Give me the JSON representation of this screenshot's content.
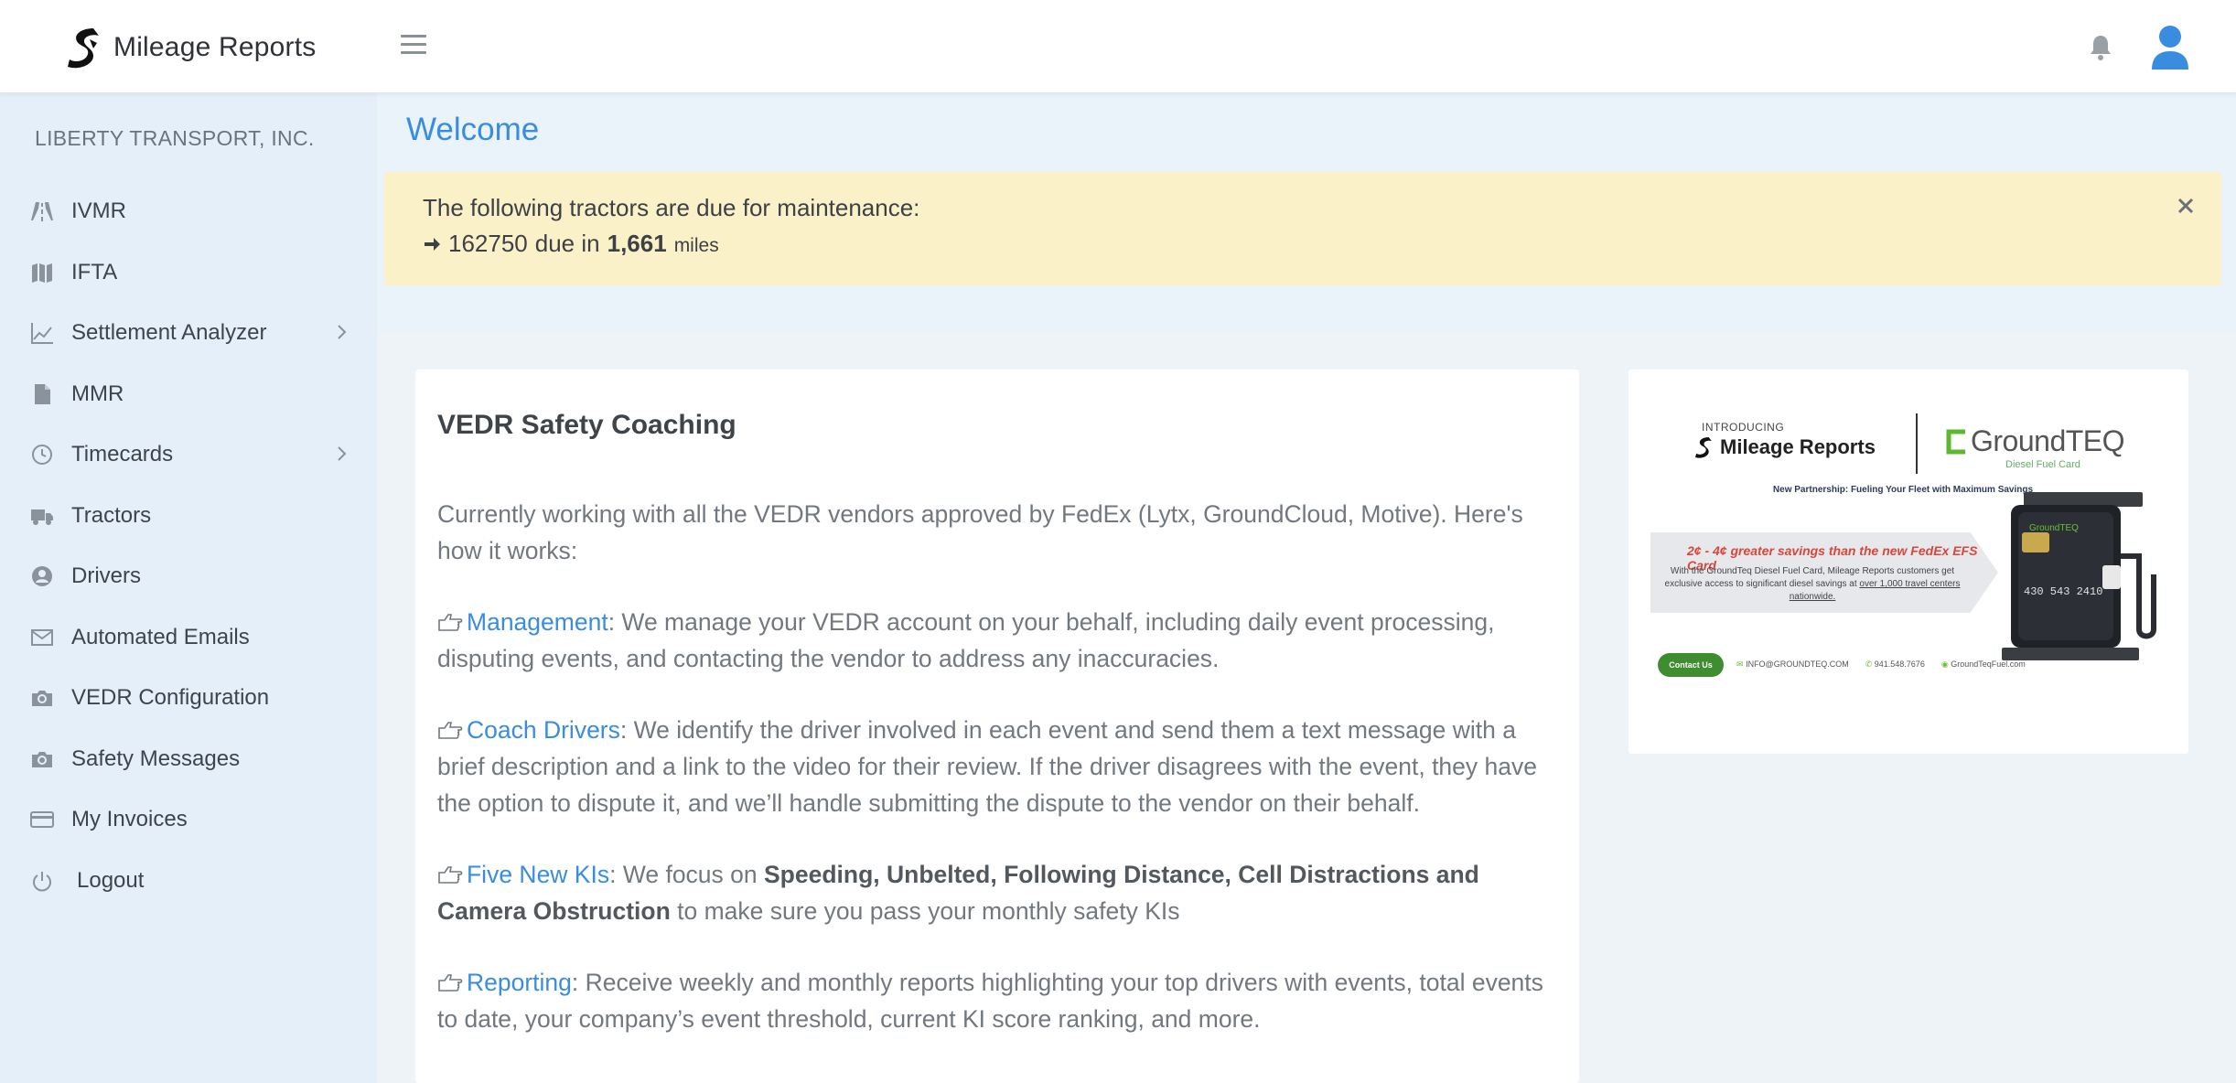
{
  "header": {
    "brand_name": "Mileage Reports",
    "icons": [
      "menu-icon",
      "bell-icon",
      "user-avatar-icon"
    ]
  },
  "sidebar": {
    "company": "LIBERTY TRANSPORT, INC.",
    "items": [
      {
        "label": "IVMR",
        "icon": "road-icon",
        "has_submenu": false
      },
      {
        "label": "IFTA",
        "icon": "map-icon",
        "has_submenu": false
      },
      {
        "label": "Settlement Analyzer",
        "icon": "line-chart-icon",
        "has_submenu": true
      },
      {
        "label": "MMR",
        "icon": "file-icon",
        "has_submenu": false
      },
      {
        "label": "Timecards",
        "icon": "clock-icon",
        "has_submenu": true
      },
      {
        "label": "Tractors",
        "icon": "truck-icon",
        "has_submenu": false
      },
      {
        "label": "Drivers",
        "icon": "user-circle-icon",
        "has_submenu": false
      },
      {
        "label": "Automated Emails",
        "icon": "envelope-icon",
        "has_submenu": false
      },
      {
        "label": "VEDR Configuration",
        "icon": "camera-icon",
        "has_submenu": false
      },
      {
        "label": "Safety Messages",
        "icon": "camera-icon",
        "has_submenu": false
      },
      {
        "label": "My Invoices",
        "icon": "credit-card-icon",
        "has_submenu": false
      },
      {
        "label": "Logout",
        "icon": "power-icon",
        "has_submenu": false
      }
    ]
  },
  "main": {
    "title": "Welcome",
    "alert": {
      "title": "The following tractors are due for maintenance:",
      "tractor": "162750",
      "due_text": "due in",
      "miles_value": "1,661",
      "miles_unit": "miles",
      "bg_color": "#fbf1c9"
    },
    "card": {
      "title": "VEDR Safety Coaching",
      "intro": "Currently working with all the VEDR vendors approved by FedEx (Lytx, GroundCloud, Motive). Here's how it works:",
      "sections": [
        {
          "heading": "Management",
          "text": ": We manage your VEDR account on your behalf, including daily event processing, disputing events, and contacting the vendor to address any inaccuracies."
        },
        {
          "heading": "Coach Drivers",
          "text": ": We identify the driver involved in each event and send them a text message with a brief description and a link to the video for their review. If the driver disagrees with the event, they have the option to dispute it, and we’ll handle submitting the dispute to the vendor on their behalf."
        },
        {
          "heading": "Five New KIs",
          "text_pre": ": We focus on ",
          "text_bold": "Speeding, Unbelted, Following Distance, Cell Distractions and Camera Obstruction",
          "text_post": " to make sure you pass your monthly safety KIs"
        },
        {
          "heading": "Reporting",
          "text": ": Receive weekly and monthly reports highlighting your top drivers with events, total events to date, your company’s event threshold, current KI score ranking, and more."
        }
      ]
    },
    "promo": {
      "intro": "INTRODUCING",
      "brand": "Mileage Reports",
      "partner_name": "GroundTEQ",
      "partner_sub": "Diesel Fuel Card",
      "tagline": "New Partnership: Fueling Your Fleet with Maximum Savings",
      "savings": "2¢ - 4¢ greater savings than the new FedEx EFS Card",
      "desc_pre": "With the GroundTeq Diesel Fuel Card, Mileage Reports customers get exclusive access to significant diesel savings at ",
      "desc_link": "over 1,000 travel centers nationwide.",
      "contact": "Contact Us",
      "email": "INFO@GROUNDTEQ.COM",
      "phone": "941.548.7676",
      "website": "GroundTeqFuel.com",
      "card_number": "430 543 2410"
    }
  },
  "colors": {
    "accent": "#3a8dde",
    "sidebar_bg": "#e4effa",
    "link": "#3a8dde"
  }
}
